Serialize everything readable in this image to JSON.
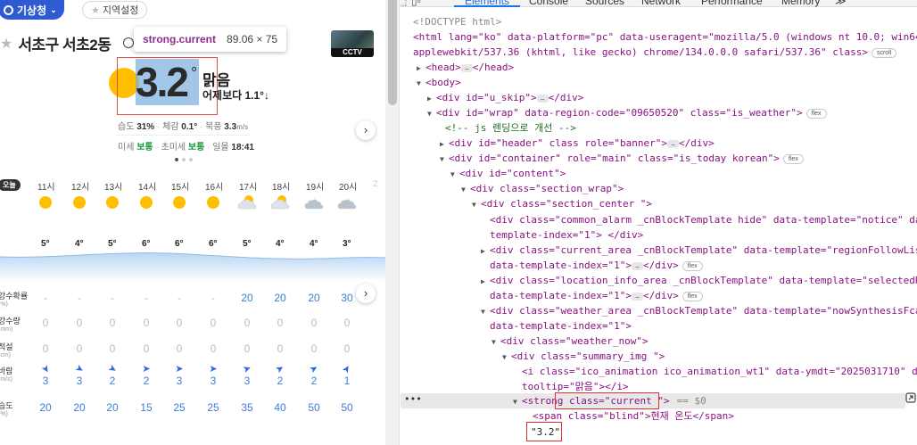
{
  "left": {
    "agency_button": "기상청",
    "region_button": "지역설정",
    "location": "서초구 서초2동",
    "inspect_tooltip": {
      "selector": "strong.current",
      "size": "89.06 × 75"
    },
    "cctv_label": "CCTV",
    "current_temp": "3.2",
    "degree": "°",
    "condition": "맑음",
    "compare": "어제보다 1.1°↓",
    "summary1": {
      "humidity_label": "습도",
      "humidity": "31%",
      "feels_label": "체감",
      "feels": "0.1°",
      "wind_label": "북풍",
      "wind": "3.3",
      "wind_unit": "m/s"
    },
    "summary2": {
      "pm10_label": "미세",
      "pm10": "보통",
      "pm25_label": "초미세",
      "pm25": "보통",
      "sunset_label": "일몰",
      "sunset": "18:41"
    },
    "today_badge": "오늘",
    "hours": [
      "11시",
      "12시",
      "13시",
      "14시",
      "15시",
      "16시",
      "17시",
      "18시",
      "19시",
      "20시",
      "2"
    ],
    "hour_icons": [
      "sun",
      "sun",
      "sun",
      "sun",
      "sun",
      "sun",
      "partly-cloudy",
      "partly-cloudy",
      "cloud",
      "cloud"
    ],
    "hour_temps": [
      "5°",
      "4°",
      "5°",
      "6°",
      "6°",
      "6°",
      "5°",
      "4°",
      "4°",
      "3°"
    ],
    "rows": [
      {
        "label": "강수확률",
        "unit": "(%)",
        "values": [
          "-",
          "-",
          "-",
          "-",
          "-",
          "-",
          "20",
          "20",
          "20",
          "30"
        ]
      },
      {
        "label": "강수량",
        "unit": "(mm)",
        "values": [
          "0",
          "0",
          "0",
          "0",
          "0",
          "0",
          "0",
          "0",
          "0",
          "0"
        ]
      },
      {
        "label": "적설",
        "unit": "(cm)",
        "values": [
          "0",
          "0",
          "0",
          "0",
          "0",
          "0",
          "0",
          "0",
          "0",
          "0"
        ]
      },
      {
        "label": "바람",
        "unit": "(m/s)",
        "values": [
          "3",
          "3",
          "2",
          "2",
          "3",
          "3",
          "3",
          "2",
          "2",
          "1"
        ]
      },
      {
        "label": "습도",
        "unit": "(%)",
        "values": [
          "20",
          "20",
          "20",
          "15",
          "25",
          "25",
          "35",
          "40",
          "50",
          "50"
        ]
      }
    ]
  },
  "devtools": {
    "tabs": [
      "Elements",
      "Console",
      "Sources",
      "Network",
      "Performance",
      "Memory",
      "≫"
    ],
    "lines": {
      "doctype": "<!DOCTYPE html>",
      "html_open": "<html lang=\"ko\" data-platform=\"pc\" data-useragent=\"mozilla/5.0 (windows nt 10.0; win64; x64)",
      "html_cont": "applewebkit/537.36 (khtml, like gecko) chrome/134.0.0.0 safari/537.36\" class>",
      "head": "<head>",
      "head_close": "</head>",
      "body": "<body>",
      "u_skip": "<div id=\"u_skip\">",
      "div_close": "</div>",
      "wrap": "<div id=\"wrap\" data-region-code=\"09650520\" class=\"is_weather\">",
      "comment": "<!-- js 렌딩으로 개선 -->",
      "header": "<div id=\"header\" class role=\"banner\">",
      "container": "<div id=\"container\" role=\"main\" class=\"is_today korean\">",
      "content": "<div id=\"content\">",
      "section_wrap": "<div class=\"section_wrap\">",
      "section_center": "<div class=\"section_center \">",
      "common_alarm": "<div class=\"common_alarm _cnBlockTemplate hide\" data-template=\"notice\" data-",
      "common_alarm2": "template-index=\"1\"> </div>",
      "current_area": "<div class=\"current_area _cnBlockTemplate\" data-template=\"regionFollowList\"",
      "current_area2": "data-template-index=\"1\">",
      "location_info": "<div class=\"location_info_area _cnBlockTemplate\" data-template=\"selectedRegion\"",
      "location_info2": "data-template-index=\"1\">",
      "weather_area": "<div class=\"weather_area _cnBlockTemplate\" data-template=\"nowSynthesisFcast\"",
      "weather_area2": "data-template-index=\"1\">",
      "weather_now": "<div class=\"weather_now\">",
      "summary_img": "<div class=\"summary_img \">",
      "ico": "<i class=\"ico_animation ico_animation_wt1\" data-ymdt=\"2025031710\" data-",
      "ico2": "tooltip=\"맑음\"></i>",
      "strong": "<strong class=\"current \">",
      "eq": "== $0",
      "span": "<span class=\"blind\">현재 온도</span>",
      "text": "\"3.2\""
    },
    "badges": {
      "scroll": "scroll",
      "flex": "flex"
    }
  }
}
